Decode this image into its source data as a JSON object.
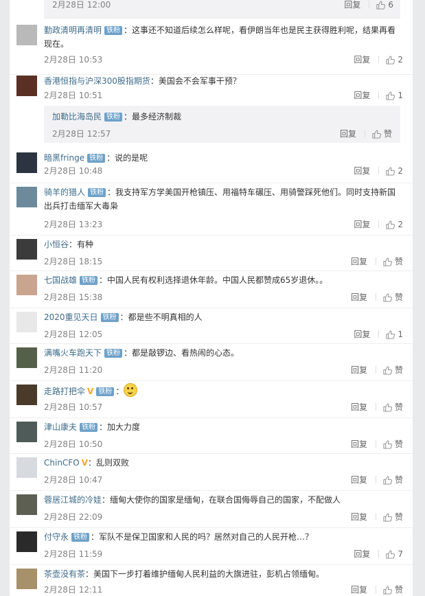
{
  "reply_label": "回复",
  "like_label": "赞",
  "top": {
    "time": "2月28日 12:00",
    "likes": "6"
  },
  "comments": [
    {
      "user": "勤政清明再清明",
      "badge": "铁粉",
      "vip": "",
      "text": "这事还不知道后续怎么样呢，看伊朗当年也是民主获得胜利呢，结果再看",
      "text2": "现在。",
      "time": "2月28日 10:53",
      "likes": "2",
      "avatar_color": "#b9b9b9"
    },
    {
      "user": "香港恒指与沪深300股指期货",
      "badge": "",
      "vip": "",
      "text": "美国会不会军事干预？",
      "text2": "",
      "time": "2月28日 10:51",
      "likes": "1",
      "avatar_color": "#5a2f24"
    },
    {
      "user": "暗黑fringe",
      "badge": "铁粉",
      "vip": "",
      "text": "说的是呢",
      "text2": "",
      "time": "2月28日 10:48",
      "likes": "2",
      "avatar_color": "#2b3440"
    },
    {
      "user": "骑羊的猎人",
      "badge": "铁粉",
      "vip": "",
      "text": "我支持军方学美国开枪镇压、用福特车碾压、用骑警踩死他们。同时支持新国",
      "text2": "出兵打击缅军大毒枭",
      "time": "2月28日 13:23",
      "likes": "2",
      "avatar_color": "#6c8a9c"
    },
    {
      "user": "小恒谷",
      "badge": "",
      "vip": "",
      "text": "有种",
      "text2": "",
      "time": "2月28日 18:15",
      "likes": "",
      "avatar_color": "#3b3b3b"
    },
    {
      "user": "七国战雄",
      "badge": "铁粉",
      "vip": "",
      "text": "中国人民有权利选择退休年龄。中国人民都赞成65岁退休。。",
      "text2": "",
      "time": "2月28日 15:38",
      "likes": "",
      "avatar_color": "#c9a58f"
    },
    {
      "user": "2020重见天日",
      "badge": "铁粉",
      "vip": "",
      "text": "都是些不明真相的人",
      "text2": "",
      "time": "2月28日 12:05",
      "likes": "1",
      "avatar_color": "#e8e8e8"
    },
    {
      "user": "满嘴火车跑天下",
      "badge": "铁粉",
      "vip": "",
      "text": "都是敲锣边、看热闹的心态。",
      "text2": "",
      "time": "2月28日 11:20",
      "likes": "",
      "avatar_color": "#55604a"
    },
    {
      "user": "走路打把伞",
      "badge": "铁粉",
      "vip": "V",
      "text": "",
      "text2": "",
      "time": "2月28日 10:57",
      "likes": "",
      "avatar_color": "#4a3a2a",
      "emoji": "smile-emoji"
    },
    {
      "user": "津山康夫",
      "badge": "铁粉",
      "vip": "",
      "text": "加大力度",
      "text2": "",
      "time": "2月28日 10:50",
      "likes": "",
      "avatar_color": "#4e5b58"
    },
    {
      "user": "ChinCFO",
      "badge": "",
      "vip": "V",
      "text": "乱则双败",
      "text2": "",
      "time": "2月28日 10:47",
      "likes": "",
      "avatar_color": "#d7dbe0"
    },
    {
      "user": "蓉居江城的冷娃",
      "badge": "",
      "vip": "",
      "text": "缅甸大使你的国家是缅甸，在联合国侮辱自己的国家，不配做人",
      "text2": "",
      "time": "2月28日 22:09",
      "likes": "",
      "avatar_color": "#5c5f52"
    },
    {
      "user": "付守永",
      "badge": "铁粉",
      "vip": "",
      "text": "军队不是保卫国家和人民的吗？居然对自己的人民开枪…？",
      "text2": "",
      "time": "2月28日 11:59",
      "likes": "7",
      "avatar_color": "#2a2a2a"
    },
    {
      "user": "茶壶没有茶",
      "badge": "",
      "vip": "",
      "text": "美国下一步打着维护缅甸人民利益的大旗进驻，彭机占领缅甸。",
      "text2": "",
      "time": "2月28日 12:11",
      "likes": "",
      "avatar_color": "#a7916a"
    }
  ],
  "sub_reply": {
    "user": "加勒比海岛民",
    "badge": "铁粉",
    "text": "最多经济制裁",
    "time": "2月28日 12:57"
  }
}
